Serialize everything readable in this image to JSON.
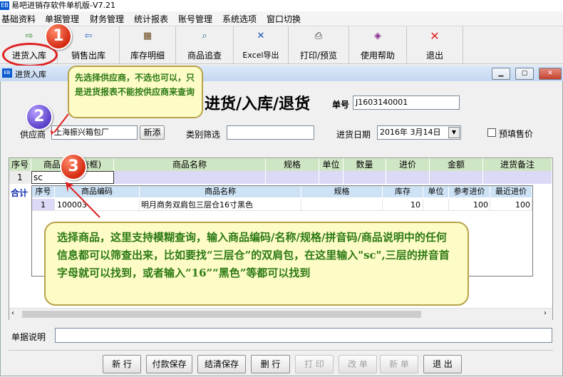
{
  "app": {
    "title": "易吧进销存软件单机版-V7.21",
    "logo_text": "EB"
  },
  "menu": [
    "基础资料",
    "单据管理",
    "财务管理",
    "统计报表",
    "账号管理",
    "系统选项",
    "窗口切换"
  ],
  "toolbar": [
    {
      "label": "进货入库",
      "icon": "stock-in-icon",
      "glyph": "⇨"
    },
    {
      "label": "销售出库",
      "icon": "sales-out-icon",
      "glyph": "⇦"
    },
    {
      "label": "库存明细",
      "icon": "inventory-icon",
      "glyph": "▦"
    },
    {
      "label": "商品追查",
      "icon": "product-trace-icon",
      "glyph": "⌕"
    },
    {
      "label": "Excel导出",
      "icon": "excel-export-icon",
      "glyph": "✕"
    },
    {
      "label": "打印/预览",
      "icon": "printer-icon",
      "glyph": "⎙"
    },
    {
      "label": "使用帮助",
      "icon": "help-icon",
      "glyph": "◈"
    },
    {
      "label": "退出",
      "icon": "exit-icon",
      "glyph": "✕"
    }
  ],
  "window": {
    "title": "进货入库",
    "icon_text": "EB"
  },
  "form": {
    "title": "进货/入库/退货",
    "doc_no_label": "单号",
    "doc_no": "J1603140001",
    "supplier_label": "供应商",
    "supplier_value": "上海振兴箱包厂",
    "new_button": "新添",
    "category_label": "类别筛选",
    "category_value": "",
    "date_label": "进货日期",
    "date_value": "2016年 3月14日",
    "prefill_label": "预填售价",
    "prefill_checked": false,
    "memo_label": "单据说明",
    "memo_value": ""
  },
  "grid": {
    "columns": [
      "序号",
      "商品编码(查框)",
      "商品名称",
      "规格",
      "单位",
      "数量",
      "进价",
      "金额",
      "进货备注"
    ],
    "row": {
      "index": "1",
      "code": "sc"
    },
    "total_label": "合计"
  },
  "dropdown": {
    "columns": [
      "序号",
      "商品编码",
      "商品名称",
      "规格",
      "库存",
      "单位",
      "参考进价",
      "最近进价"
    ],
    "rows": [
      {
        "index": "1",
        "code": "100003",
        "name": "明月商务双肩包三层仓16寸黑色",
        "spec": "",
        "stock": "10",
        "unit": "",
        "ref_price": "100",
        "last_price": "100"
      }
    ]
  },
  "buttons": [
    {
      "label": "新 行",
      "enabled": true
    },
    {
      "label": "付款保存",
      "enabled": true
    },
    {
      "label": "结清保存",
      "enabled": true
    },
    {
      "label": "删 行",
      "enabled": true
    },
    {
      "label": "打 印",
      "enabled": false
    },
    {
      "label": "改 单",
      "enabled": false
    },
    {
      "label": "新 单",
      "enabled": false
    },
    {
      "label": "退 出",
      "enabled": true
    }
  ],
  "annotations": {
    "step1": "1",
    "step2": "2",
    "step3": "3",
    "callout_top": "先选择供应商，不选也可以，只是进货报表不能按供应商来查询",
    "callout_bottom": "选择商品，这里支持模糊查询，输入商品编码/名称/规格/拼音码/商品说明中的任何信息都可以筛查出来，比如要找“三层仓”的双肩包，在这里输入\"sc\",三层的拼音首字母就可以找到，或者输入“16”“黑色”等都可以找到"
  },
  "colors": {
    "accent_red": "#e02020",
    "callout_bg": "#fefcc6",
    "callout_text": "#2d7a15",
    "grid_header": "#cfe6c4",
    "selected_row": "#dcd9f6"
  }
}
